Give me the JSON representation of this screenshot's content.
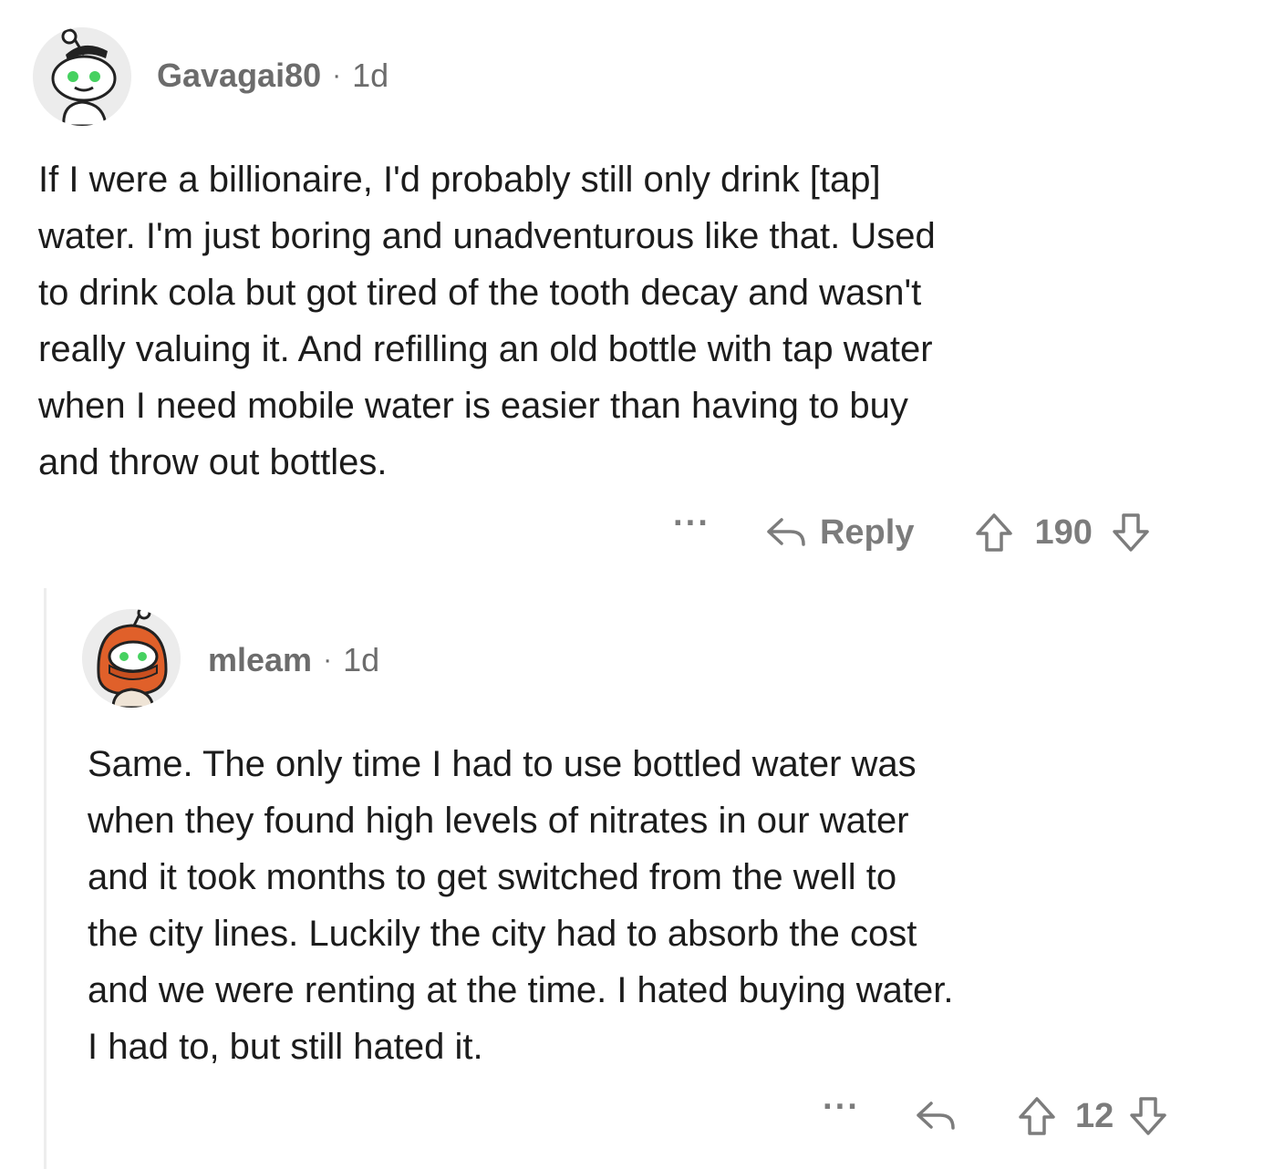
{
  "comments": [
    {
      "username": "Gavagai80",
      "separator": "·",
      "age": "1d",
      "avatar_icon": "snoo-avatar-icon",
      "body_lines": [
        "If I were a billionaire, I'd probably still only drink [tap]",
        "water. I'm just boring and unadventurous like that. Used",
        "to drink cola but got tired of the tooth decay and wasn't",
        "really valuing it. And refilling an old bottle with tap water",
        "when I need mobile water is easier than having to  buy",
        "and throw out bottles."
      ],
      "more_label": "···",
      "reply_label": "Reply",
      "vote_count": "190"
    },
    {
      "username": "mleam",
      "separator": "·",
      "age": "1d",
      "avatar_icon": "snoo-hooded-avatar-icon",
      "body_lines": [
        "Same. The only time I had to use bottled water was",
        "when they found high levels of nitrates in our water",
        "and it took months to get switched from the well to",
        "the city lines. Luckily the city had to absorb the cost",
        "and we were renting at the time. I hated buying water.",
        "I had to, but still hated it."
      ],
      "more_label": "···",
      "reply_label": "",
      "vote_count": "12"
    }
  ],
  "colors": {
    "text": "#1c1c1c",
    "meta": "#6c6c6c",
    "action": "#7c7c7c",
    "avatar_bg": "#ececec",
    "snoo_eye": "#46d160",
    "hood": "#e0602a"
  }
}
